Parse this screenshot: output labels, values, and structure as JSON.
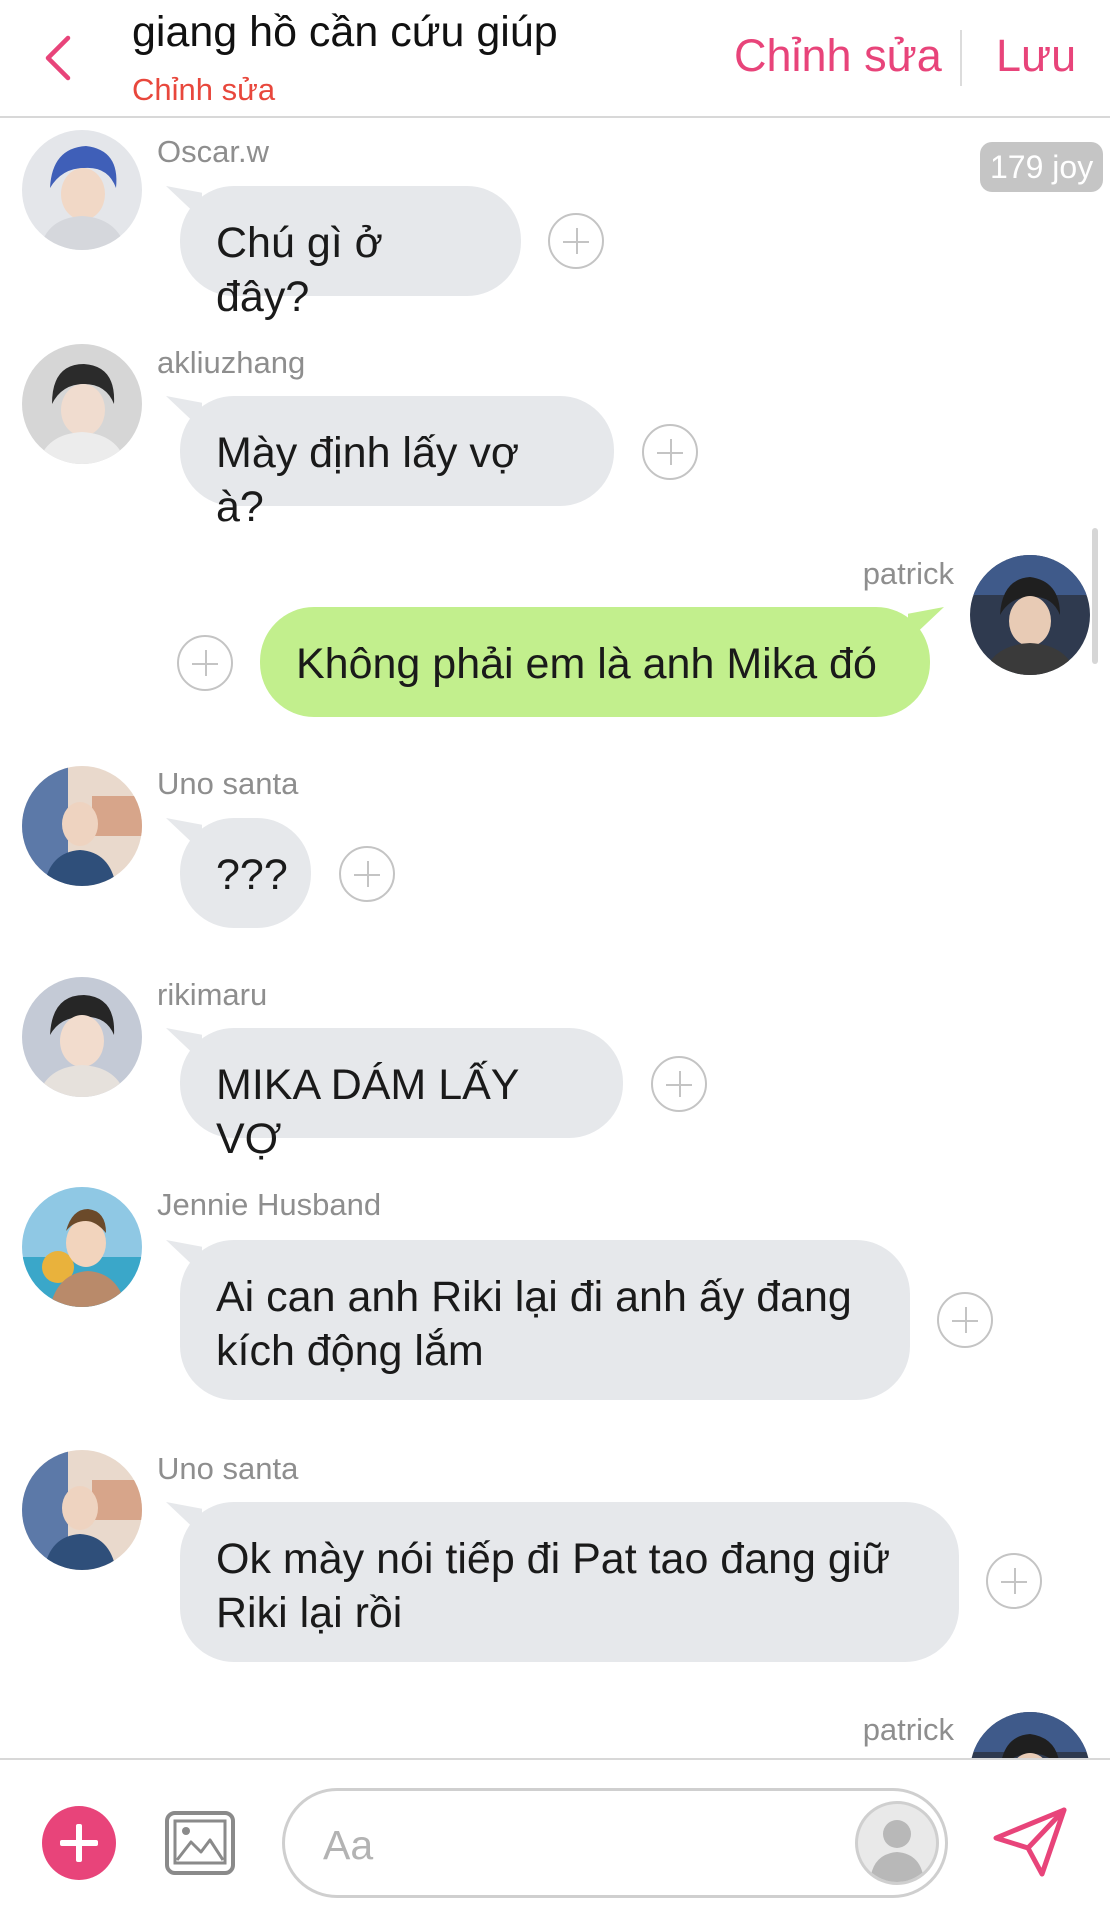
{
  "header": {
    "title": "giang hồ cần cứu giúp",
    "subtitle": "Chỉnh sửa",
    "edit_label": "Chỉnh sửa",
    "save_label": "Lưu"
  },
  "badge": {
    "label": "179 joy"
  },
  "messages": [
    {
      "sender": "Oscar.w",
      "text": "Chú gì ở đây?"
    },
    {
      "sender": "akliuzhang",
      "text": "Mày định lấy vợ à?"
    },
    {
      "sender": "patrick",
      "text": "Không phải em là anh Mika đó"
    },
    {
      "sender": "Uno santa",
      "text": "???"
    },
    {
      "sender": "rikimaru",
      "text": "MIKA DÁM LẤY VỢ"
    },
    {
      "sender": "Jennie Husband",
      "text": "Ai can anh Riki lại đi anh ấy đang kích động lắm"
    },
    {
      "sender": "Uno santa",
      "text": "Ok mày nói tiếp đi Pat tao đang giữ Riki lại rồi"
    },
    {
      "sender": "patrick",
      "text": ""
    }
  ],
  "composer": {
    "placeholder": "Aa"
  },
  "colors": {
    "accent": "#e8447a",
    "subtitle": "#e8473c",
    "my_bubble": "#c2ef8d",
    "other_bubble": "#e6e8eb"
  },
  "icons": {
    "back": "chevron-left-icon",
    "add": "plus-circle-icon",
    "image": "image-icon",
    "persona": "person-silhouette-icon",
    "send": "paper-plane-icon",
    "reaction": "add-reaction-icon"
  }
}
